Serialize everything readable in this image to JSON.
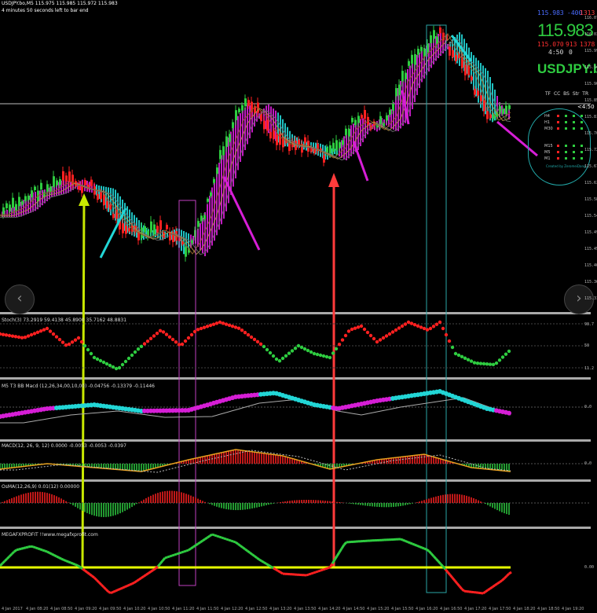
{
  "header": {
    "line1": "USDJPY.bo,M5  115.975 115.985 115.972 115.983",
    "line2": "4 minutes 50 seconds left to bar end"
  },
  "quote": {
    "bid_small": "115.983",
    "spread": "-400",
    "volume": "1313",
    "price": "115.983",
    "low": "115.070",
    "count": "913",
    "other": "1378",
    "timer": "4:50",
    "zero": "0",
    "symbol": "USDJPY.bo",
    "price_line_label": "<4:50"
  },
  "tf_box": {
    "headers": [
      "TF",
      "CC",
      "BS",
      "Str",
      "TR"
    ],
    "rows": [
      "H4",
      "H1",
      "M30",
      "M15",
      "M5",
      "M1"
    ],
    "credit": "Created by ZeromeiDang"
  },
  "panels": {
    "stoch_label": "Stoch(3) 73.2919 59.4138 45.8900 35.7162 48.8831",
    "ma_label": "M5  T3 BB Macd (12,26,34,00,10,00) -0.04756 -0.13379 -0.11446",
    "macd_label": "MACD(12, 26, 9, 12) 0.0000 -0.0053 -0.0053 -0.0397",
    "osma_label": "OsMA(12,26,9) 0.01(12) 0.00000",
    "profit_label": "MEGAFXPROFIT !!www.megafxprofit.com"
  },
  "axis_ticks": {
    "price": [
      "116.075",
      "116.035",
      "115.990",
      "115.945",
      "115.900",
      "115.855",
      "115.810",
      "115.765",
      "115.720",
      "115.675",
      "115.630",
      "115.585",
      "115.540",
      "115.495",
      "115.450",
      "115.405",
      "115.360",
      "115.315"
    ],
    "stoch": [
      "98.7",
      "50",
      "11.2"
    ],
    "ma": [
      "0.0"
    ],
    "macd": [
      "0.0"
    ],
    "profit": [
      "0.00"
    ]
  },
  "time_labels": [
    "4 Jan 2017",
    "4 Jan 08:20",
    "4 Jan 08:50",
    "4 Jan 09:20",
    "4 Jan 09:50",
    "4 Jan 10:20",
    "4 Jan 10:50",
    "4 Jan 11:20",
    "4 Jan 11:50",
    "4 Jan 12:20",
    "4 Jan 12:50",
    "4 Jan 13:20",
    "4 Jan 13:50",
    "4 Jan 14:20",
    "4 Jan 14:50",
    "4 Jan 15:20",
    "4 Jan 15:50",
    "4 Jan 16:20",
    "4 Jan 16:50",
    "4 Jan 17:20",
    "4 Jan 17:50",
    "4 Jan 18:20",
    "4 Jan 18:50",
    "4 Jan 19:20"
  ],
  "colors": {
    "bull": "#2ecc40",
    "bear": "#ff2020",
    "cloud_up": "#d61ed6",
    "cloud_down": "#22d6d6",
    "signal_yellow": "#e6ff00",
    "signal_red": "#ff3b3b",
    "box_magenta": "#c040c0",
    "box_cyan": "#2aa6a6"
  },
  "nav": {
    "left": "‹",
    "right": "›"
  }
}
